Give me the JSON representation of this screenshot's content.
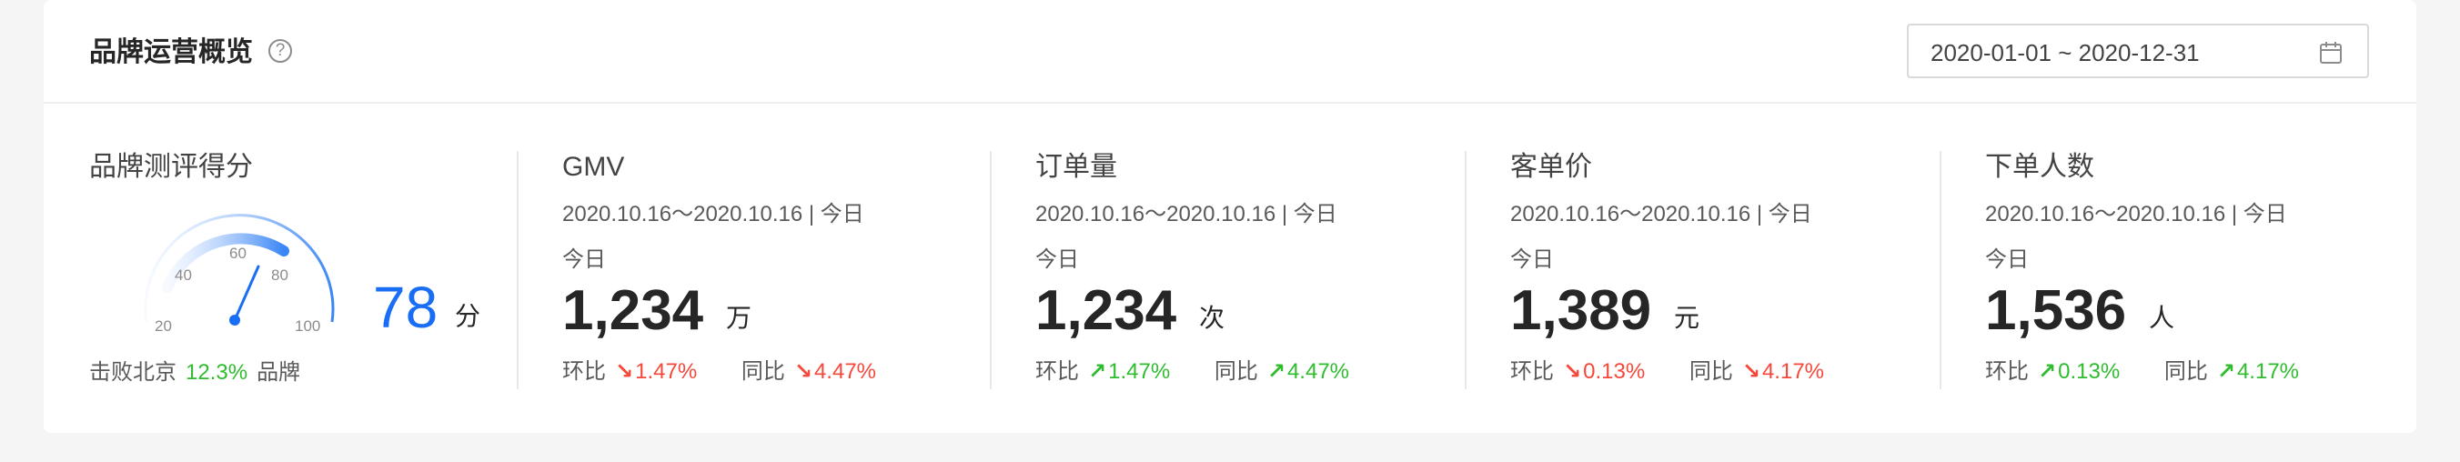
{
  "header": {
    "title": "品牌运营概览",
    "help_icon": "?",
    "date_range": "2020-01-01 ~ 2020-12-31"
  },
  "gauge": {
    "title": "品牌测评得分",
    "ticks": [
      "20",
      "40",
      "60",
      "80",
      "100"
    ],
    "score": "78",
    "unit": "分",
    "beat_prefix": "击败北京",
    "beat_percent": "12.3%",
    "beat_suffix": "品牌",
    "score_value": 78,
    "accent_color": "#1a6ef5"
  },
  "metrics": [
    {
      "title": "GMV",
      "date": "2020.10.16～2020.10.16 | 今日",
      "today": "今日",
      "value": "1,234",
      "unit": "万",
      "mom_label": "环比",
      "mom_arrow": "↘",
      "mom_value": "1.47%",
      "mom_trend": "down",
      "yoy_label": "同比",
      "yoy_arrow": "↘",
      "yoy_value": "4.47%",
      "yoy_trend": "down"
    },
    {
      "title": "订单量",
      "date": "2020.10.16～2020.10.16 | 今日",
      "today": "今日",
      "value": "1,234",
      "unit": "次",
      "mom_label": "环比",
      "mom_arrow": "↗",
      "mom_value": "1.47%",
      "mom_trend": "up",
      "yoy_label": "同比",
      "yoy_arrow": "↗",
      "yoy_value": "4.47%",
      "yoy_trend": "up"
    },
    {
      "title": "客单价",
      "date": "2020.10.16～2020.10.16 | 今日",
      "today": "今日",
      "value": "1,389",
      "unit": "元",
      "mom_label": "环比",
      "mom_arrow": "↘",
      "mom_value": "0.13%",
      "mom_trend": "down",
      "yoy_label": "同比",
      "yoy_arrow": "↘",
      "yoy_value": "4.17%",
      "yoy_trend": "down"
    },
    {
      "title": "下单人数",
      "date": "2020.10.16～2020.10.16 | 今日",
      "today": "今日",
      "value": "1,536",
      "unit": "人",
      "mom_label": "环比",
      "mom_arrow": "↗",
      "mom_value": "0.13%",
      "mom_trend": "up",
      "yoy_label": "同比",
      "yoy_arrow": "↗",
      "yoy_value": "4.17%",
      "yoy_trend": "up"
    }
  ],
  "colors": {
    "up": "#2fbc2f",
    "down": "#f5483b",
    "primary": "#1a6ef5"
  }
}
